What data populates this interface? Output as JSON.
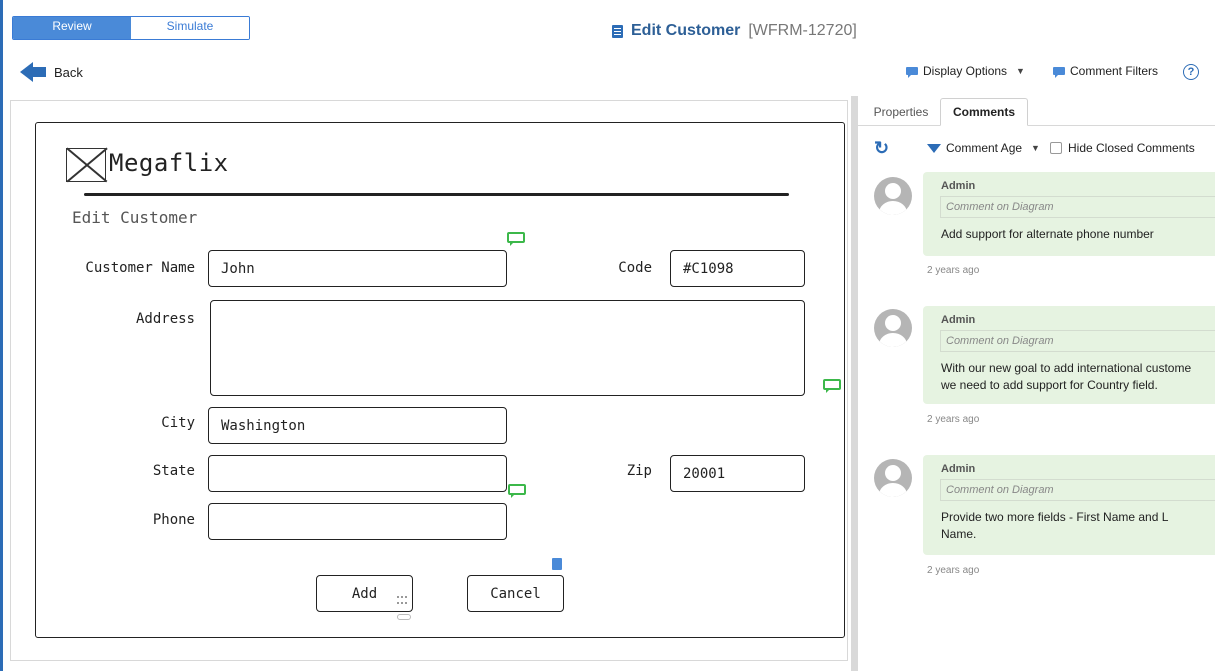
{
  "header": {
    "mode_tabs": [
      {
        "label": "Review",
        "active": true
      },
      {
        "label": "Simulate",
        "active": false
      }
    ],
    "title": "Edit Customer",
    "title_code": "[WFRM-12720]",
    "back_label": "Back",
    "display_options_label": "Display Options",
    "comment_filters_label": "Comment Filters",
    "help_label": "?"
  },
  "mockup": {
    "brand": "Megaflix",
    "heading": "Edit Customer",
    "fields": {
      "customer_name": {
        "label": "Customer Name",
        "value": "John"
      },
      "code": {
        "label": "Code",
        "value": "#C1098"
      },
      "address": {
        "label": "Address",
        "value": ""
      },
      "city": {
        "label": "City",
        "value": "Washington"
      },
      "state": {
        "label": "State",
        "value": ""
      },
      "zip": {
        "label": "Zip",
        "value": "20001"
      },
      "phone": {
        "label": "Phone",
        "value": ""
      }
    },
    "buttons": {
      "add": "Add",
      "cancel": "Cancel"
    }
  },
  "panel": {
    "tabs": [
      {
        "label": "Properties",
        "active": false
      },
      {
        "label": "Comments",
        "active": true
      }
    ],
    "filter_label": "Comment Age",
    "hide_closed_label": "Hide Closed Comments",
    "hide_closed_checked": false,
    "comments": [
      {
        "author": "Admin",
        "context": "Comment on Diagram",
        "text": "Add support for alternate phone number",
        "age": "2 years ago"
      },
      {
        "author": "Admin",
        "context": "Comment on Diagram",
        "text": "With our new goal to add international custome\nwe need to add support for Country field.",
        "age": "2 years ago"
      },
      {
        "author": "Admin",
        "context": "Comment on Diagram",
        "text": "Provide two more fields - First Name and L\nName.",
        "age": "2 years ago"
      }
    ]
  },
  "colors": {
    "accent": "#2c6cb6",
    "comment_bg": "#e6f3e1",
    "comment_marker": "#3cb84a"
  }
}
